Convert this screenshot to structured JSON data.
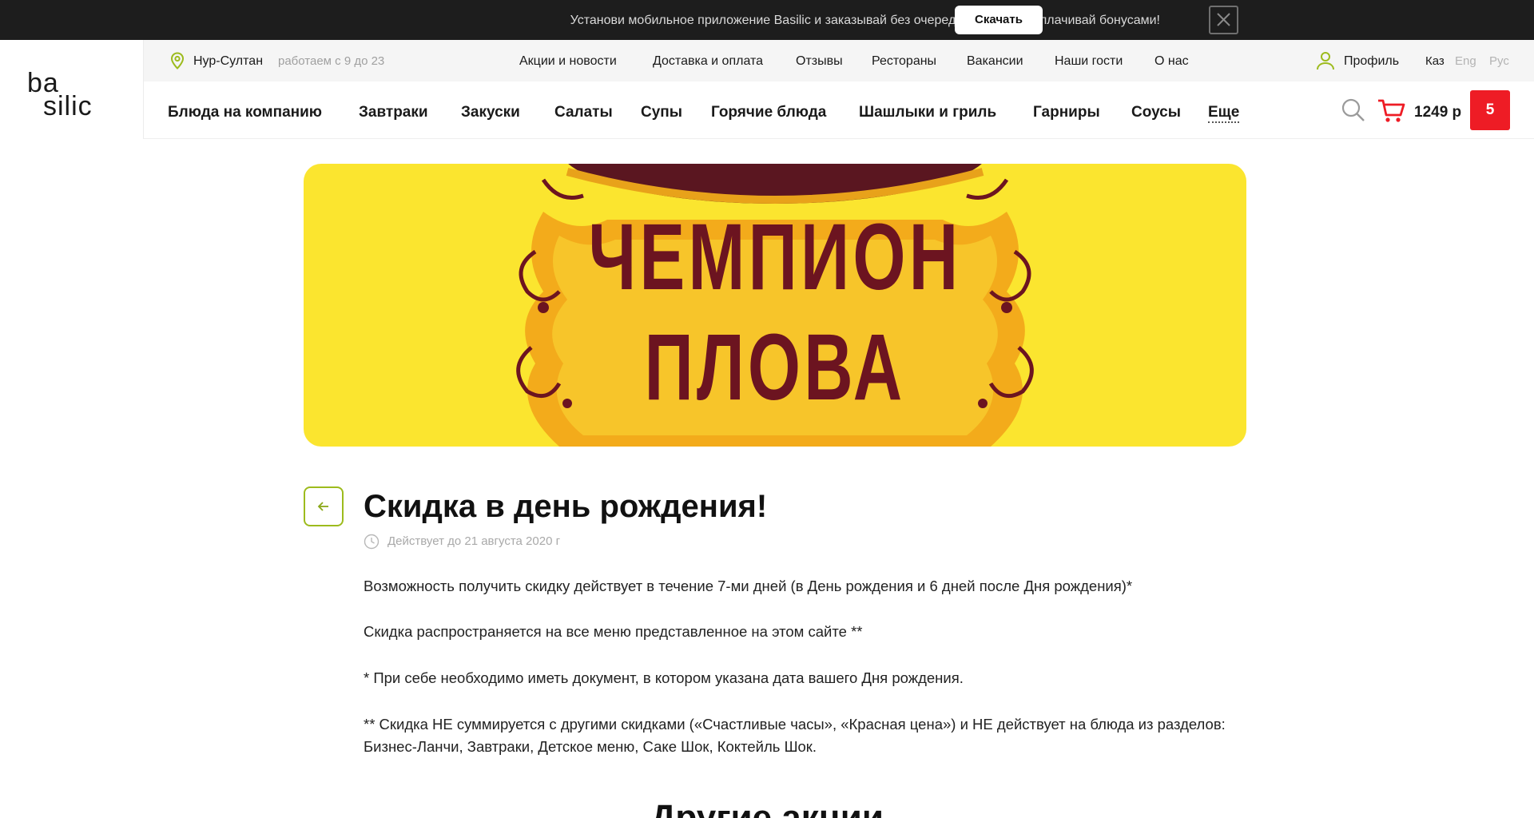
{
  "promo_bar": {
    "message": "Установи мобильное приложение Basilic и заказывай без очереди, получай и оплачивай бонусами!",
    "download_label": "Скачать",
    "close_icon": "close-icon"
  },
  "logo": {
    "line1": "ba",
    "line2": "silic"
  },
  "topbar": {
    "city": "Нур-Султан",
    "hours": "работаем с 9 до 23",
    "links": [
      "Акции и новости",
      "Доставка и оплата",
      "Отзывы",
      "Рестораны",
      "Вакансии",
      "Наши гости",
      "О нас"
    ],
    "profile_label": "Профиль",
    "languages": [
      {
        "label": "Каз",
        "active": true
      },
      {
        "label": "Eng",
        "active": false
      },
      {
        "label": "Рус",
        "active": false
      }
    ]
  },
  "categories": [
    "Блюда на компанию",
    "Завтраки",
    "Закуски",
    "Салаты",
    "Супы",
    "Горячие блюда",
    "Шашлыки и гриль",
    "Гарниры",
    "Соусы",
    "Еще"
  ],
  "cart": {
    "total": "1249 р",
    "count": "5"
  },
  "banner": {
    "line1": "ЧЕМПИОН",
    "line2": "ПЛОВА"
  },
  "article": {
    "title": "Скидка в день рождения!",
    "valid_until": "Действует до 21 августа 2020 г",
    "paragraphs": [
      "Возможность получить скидку действует в течение 7-ми дней (в День рождения и 6 дней после Дня рождения)*",
      "Скидка распространяется на все меню представленное на этом сайте **",
      "* При себе необходимо иметь документ, в котором указана дата вашего Дня рождения.",
      "** Скидка НЕ суммируется с другими скидками («Счастливые часы», «Красная цена») и НЕ действует на блюда из разделов: Бизнес-Ланчи, Завтраки, Детское меню, Саке Шок, Коктейль Шок."
    ],
    "other_heading": "Другие акции"
  },
  "colors": {
    "accent_green": "#9dbb1d",
    "cart_red": "#ee1c25",
    "banner_yellow": "#fbe52f",
    "banner_text": "#6c1420",
    "promo_bg": "#1d1d1d"
  }
}
